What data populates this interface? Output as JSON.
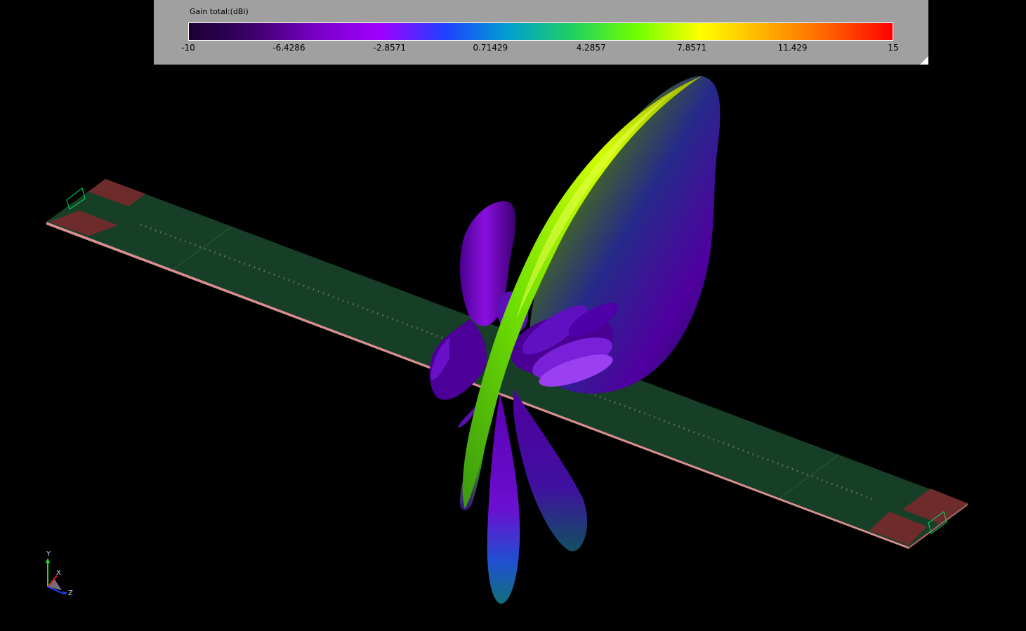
{
  "legend": {
    "title": "Gain total:(dBi)",
    "ticks": [
      "-10",
      "-6.4286",
      "-2.8571",
      "0.71429",
      "4.2857",
      "7.8571",
      "11.429",
      "15"
    ],
    "colormap": [
      "#1a0033",
      "#3d006b",
      "#7a00c8",
      "#a000ff",
      "#2040ff",
      "#00a0d0",
      "#20d060",
      "#70ff00",
      "#ffff00",
      "#ffb000",
      "#ff6000",
      "#ff0000"
    ]
  },
  "axes": {
    "x_label": "X",
    "y_label": "Y",
    "z_label": "Z"
  },
  "colors": {
    "background": "#000000",
    "substrate": "#173f27",
    "port_pad": "#6e2b2b",
    "edge": "#d08080",
    "port_box": "#00e060"
  }
}
